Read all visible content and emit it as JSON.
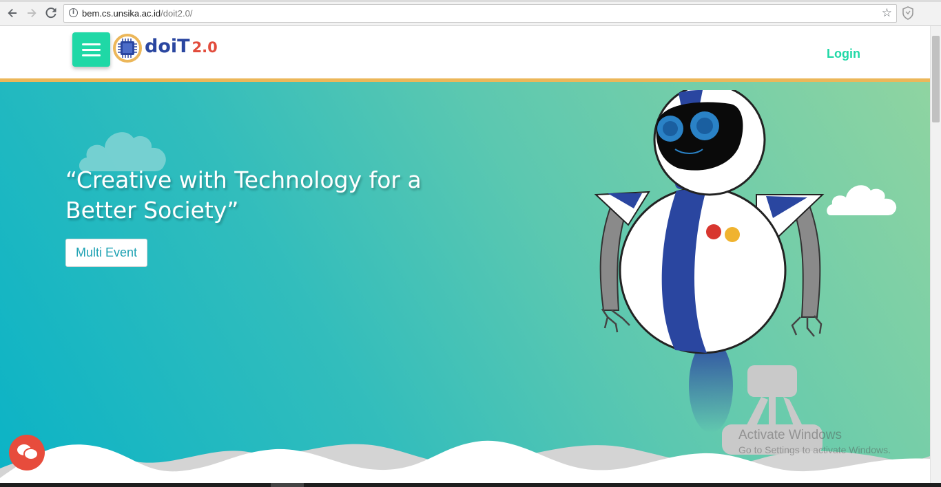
{
  "browser": {
    "url_host": "bem.cs.unsika.ac.id",
    "url_path": "/doit2.0/",
    "icons": [
      "back-arrow-icon",
      "forward-arrow-icon",
      "reload-icon",
      "info-icon",
      "star-icon",
      "shield-icon"
    ]
  },
  "header": {
    "logo_text_main": "doiT",
    "logo_text_version": "2.0",
    "login_label": "Login"
  },
  "hero": {
    "headline": "“Creative with Technology for a Better Society”",
    "cta_label": "Multi Event"
  },
  "watermark": {
    "line1": "Activate Windows",
    "line2": "Go to Settings to activate Windows."
  },
  "colors": {
    "accent": "#1fd8a6",
    "header_border": "#ecb75a",
    "robot_blue": "#2a46a0",
    "cta_text": "#1fa2b3",
    "chat_fab": "#e74c3c"
  }
}
